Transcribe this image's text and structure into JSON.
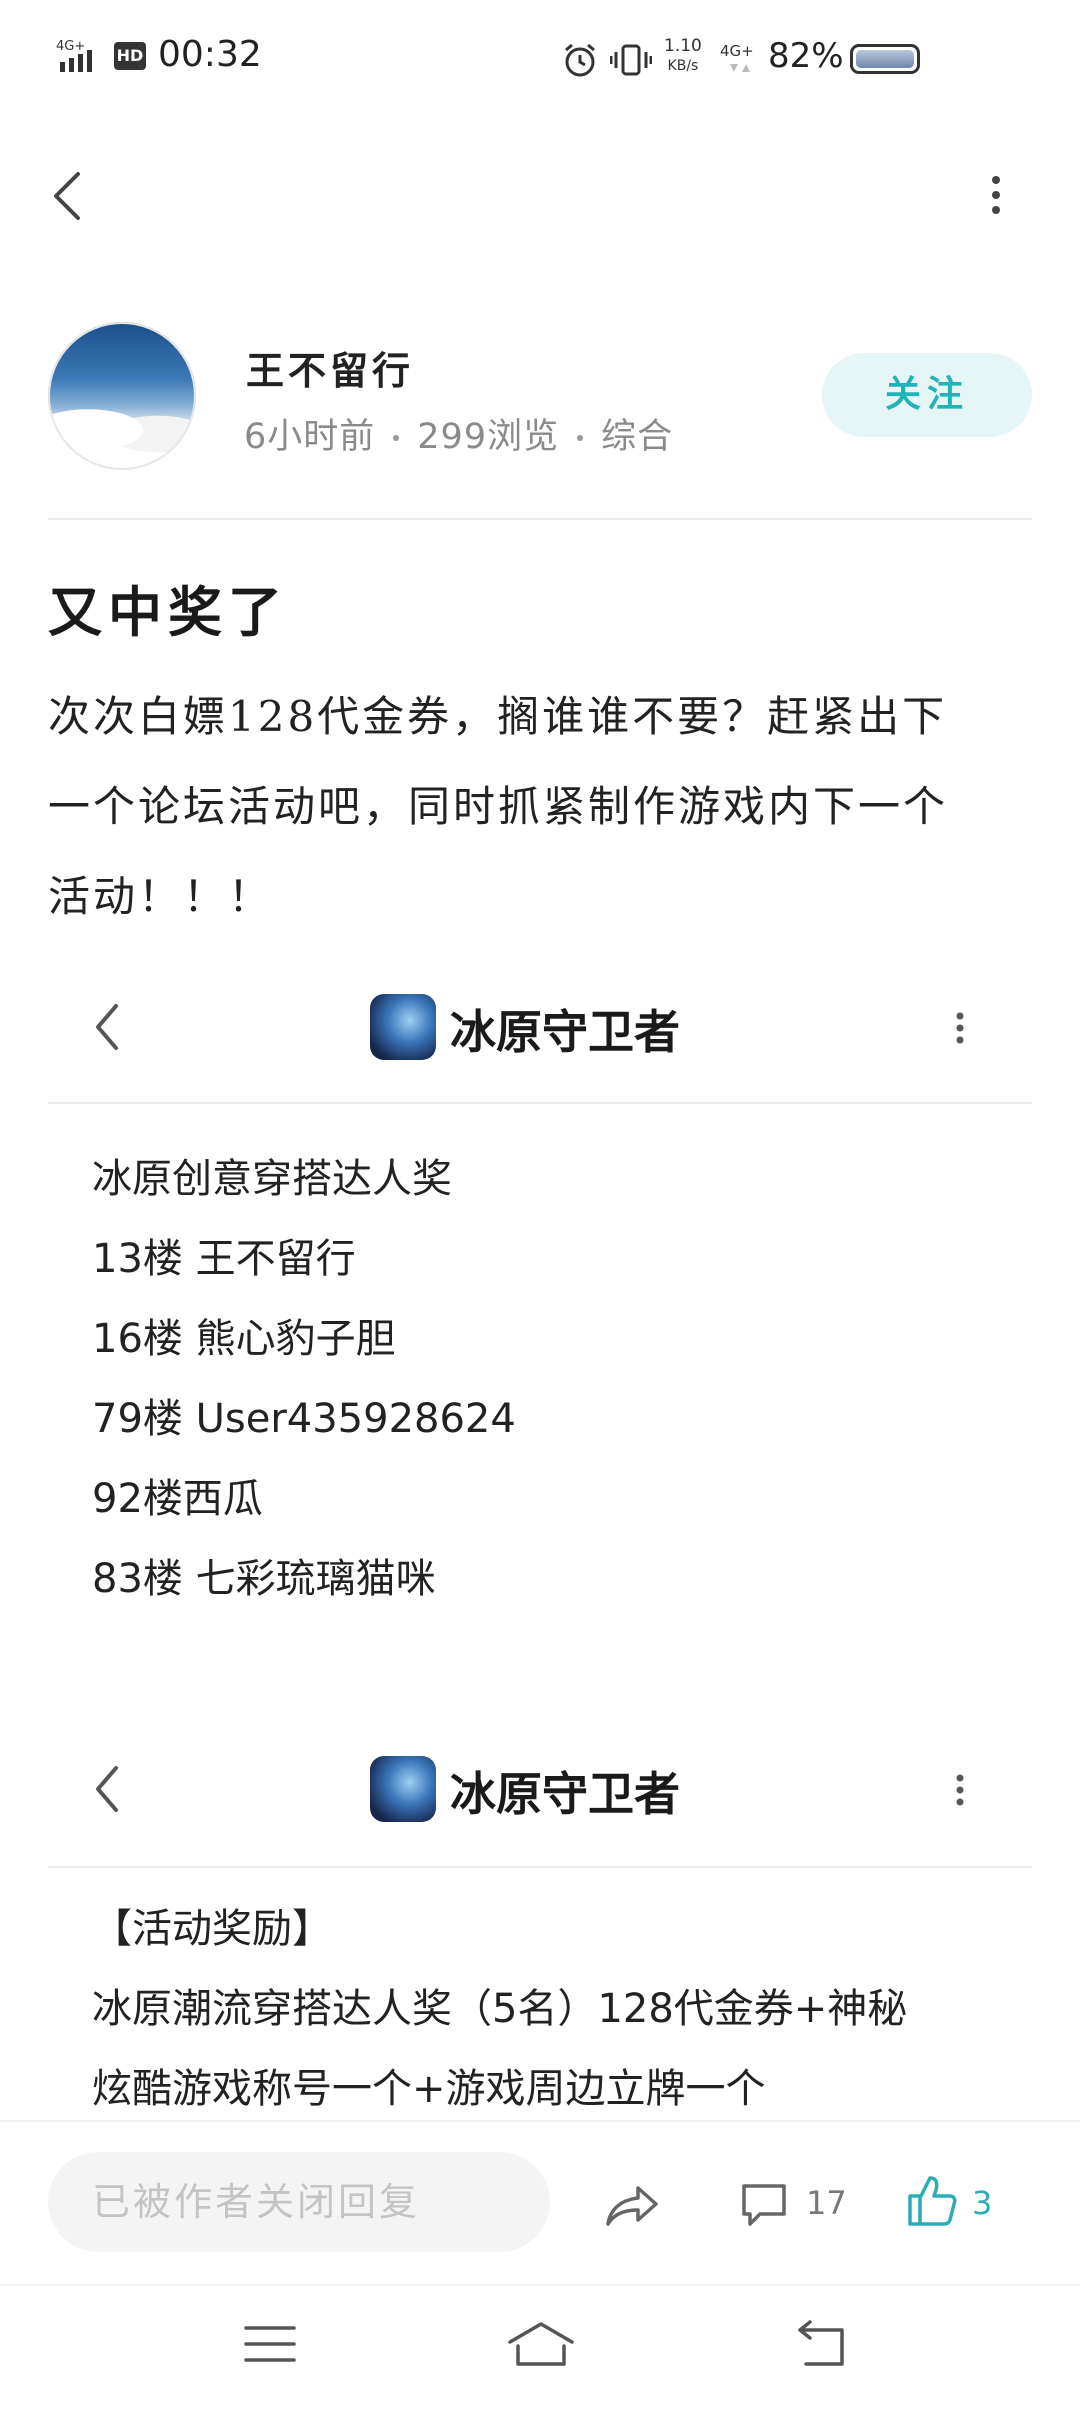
{
  "status_bar": {
    "network_left": "4G⁺",
    "hd": "HD",
    "time": "00:32",
    "speed_value": "1.10",
    "speed_unit": "KB/s",
    "network_right": "4G⁺",
    "battery": "82%"
  },
  "author": {
    "name": "王不留行",
    "time": "6小时前",
    "views": "299浏览",
    "category": "综合",
    "follow_label": "关注"
  },
  "post": {
    "title": "又中奖了",
    "body_lines": [
      "次次白嫖128代金券，搁谁谁不要？赶紧出下",
      "一个论坛活动吧，同时抓紧制作游戏内下一个",
      "活动！！！"
    ]
  },
  "embedded1": {
    "app_title": "冰原守卫者",
    "lines": [
      "冰原创意穿搭达人奖",
      "13楼 王不留行",
      "16楼 熊心豹子胆",
      "79楼 User435928624",
      "92楼西瓜",
      "83楼 七彩琉璃猫咪"
    ]
  },
  "embedded2": {
    "app_title": "冰原守卫者",
    "lines": [
      "【活动奖励】",
      "冰原潮流穿搭达人奖（5名）128代金券+神秘",
      "炫酷游戏称号一个+游戏周边立牌一个"
    ]
  },
  "bottom_bar": {
    "reply_placeholder": "已被作者关闭回复",
    "comment_count": "17",
    "like_count": "3"
  },
  "colors": {
    "accent": "#2aaeb4",
    "follow_bg": "#e6f6f7",
    "meta_gray": "#8a8a8a"
  }
}
